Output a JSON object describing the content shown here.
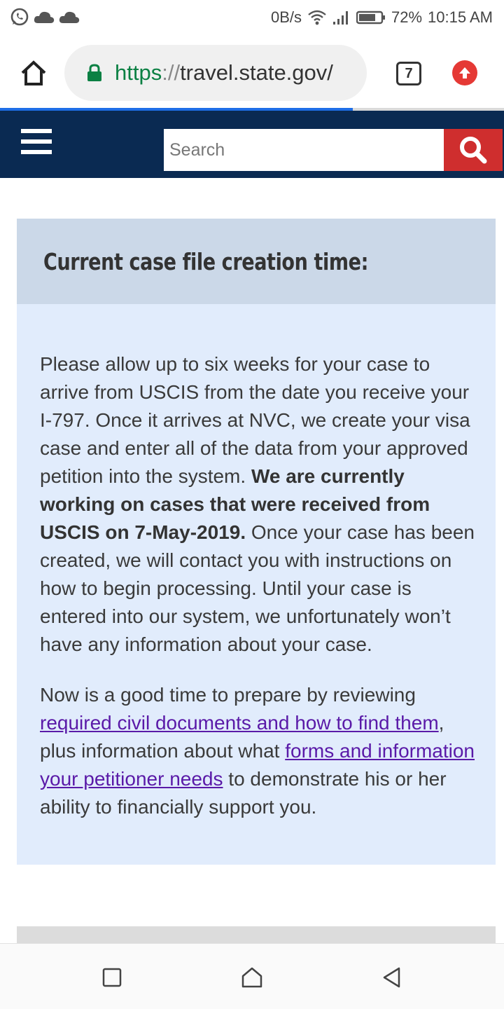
{
  "status_bar": {
    "icons_left": [
      "whatsapp-icon",
      "cloud-icon",
      "cloud-icon"
    ],
    "network_speed": "0B/s",
    "battery": "72%",
    "time": "10:15 AM"
  },
  "browser": {
    "url_scheme": "https",
    "url_separator": "://",
    "url_host": "travel.state.gov/",
    "tab_count": "7",
    "load_progress": 0.7
  },
  "site_header": {
    "search_placeholder": "Search",
    "colors": {
      "header_bg": "#0a2a52",
      "search_button": "#cf2e2e"
    }
  },
  "panel": {
    "title": "Current case file creation time:",
    "paragraph1": {
      "text_before": "Please allow up to six weeks for your case to arrive from USCIS from the date you receive your I-797. Once it arrives at NVC, we create your visa case and enter all of the data from your approved petition into the system. ",
      "bold": "We are currently working on cases that were received from USCIS on 7-May-2019.",
      "text_after": " Once your case has been created, we will contact you with instructions on how to begin processing. Until your case is entered into our system, we unfortunately won’t have any information about your case."
    },
    "paragraph2": {
      "text_before": "Now is a good time to prepare by reviewing ",
      "link1": "required civil documents and how to find them",
      "text_middle": ", plus information about what ",
      "link2": "forms and information your petitioner needs",
      "text_after": " to demonstrate his or her ability to financially support you."
    },
    "colors": {
      "panel_bg": "#e1ecfc",
      "header_bg": "#cbd8e8",
      "link": "#5a1aa8"
    }
  },
  "nav_bar": {
    "buttons": [
      "recents-square-icon",
      "home-icon",
      "back-triangle-icon"
    ]
  }
}
